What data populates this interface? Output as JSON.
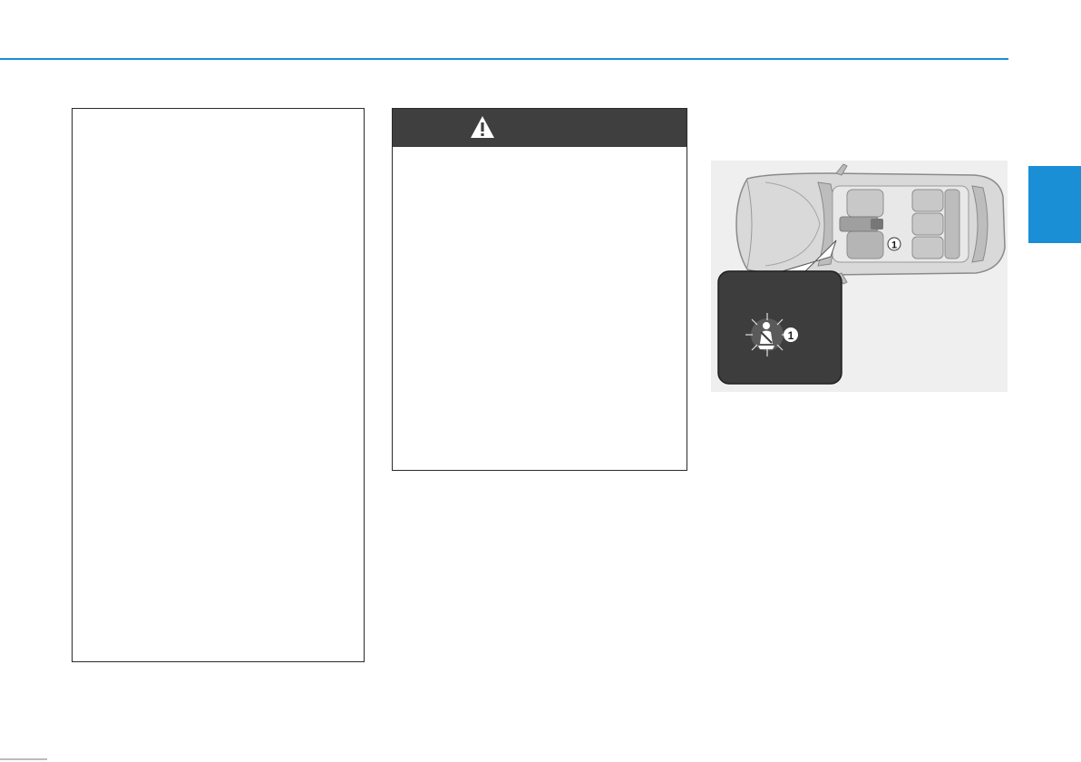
{
  "header": {
    "rule_color": "#1a8fd6",
    "section_tab_color": "#1a8fd6"
  },
  "left_box": {},
  "warning_box": {
    "header_color": "#3f3f3f",
    "icon": "warning-triangle-icon"
  },
  "figure": {
    "background": "#efefef",
    "callout_car": "1",
    "callout_inset": "1",
    "inset_icon": "seat-belt-warning-icon"
  }
}
